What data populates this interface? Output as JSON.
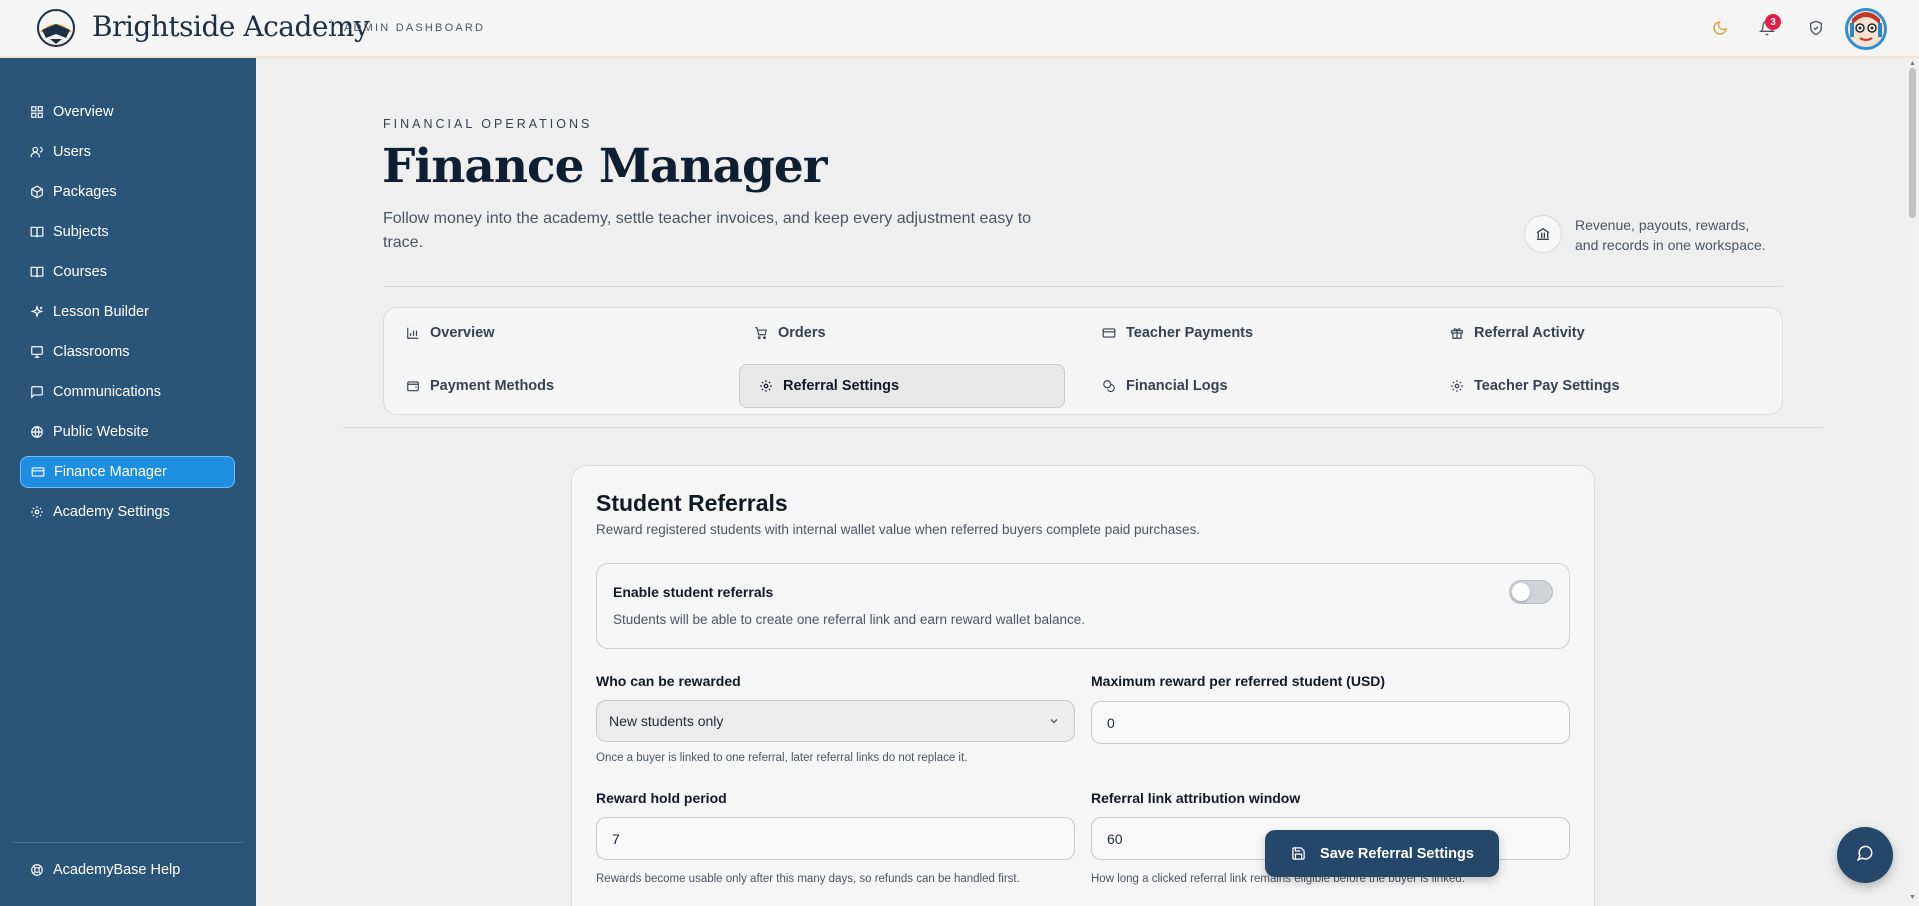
{
  "header": {
    "brand": "Brightside Academy",
    "subtitle": "ADMIN DASHBOARD",
    "notification_count": "3",
    "icons": [
      "moon-icon",
      "bell-icon",
      "shield-icon",
      "avatar"
    ]
  },
  "sidebar": {
    "items": [
      {
        "label": "Overview",
        "icon": "grid-icon"
      },
      {
        "label": "Users",
        "icon": "users-icon"
      },
      {
        "label": "Packages",
        "icon": "package-icon"
      },
      {
        "label": "Subjects",
        "icon": "book-icon"
      },
      {
        "label": "Courses",
        "icon": "book-open-icon"
      },
      {
        "label": "Lesson Builder",
        "icon": "sparkles-icon"
      },
      {
        "label": "Classrooms",
        "icon": "presentation-icon"
      },
      {
        "label": "Communications",
        "icon": "message-icon"
      },
      {
        "label": "Public Website",
        "icon": "globe-icon"
      },
      {
        "label": "Finance Manager",
        "icon": "credit-card-icon",
        "active": true
      },
      {
        "label": "Academy Settings",
        "icon": "gear-icon"
      }
    ],
    "help": {
      "label": "AcademyBase Help",
      "icon": "lifebuoy-icon"
    }
  },
  "page": {
    "eyebrow": "FINANCIAL OPERATIONS",
    "title": "Finance Manager",
    "description": "Follow money into the academy, settle teacher invoices, and keep every adjustment easy to trace.",
    "side_note": "Revenue, payouts, rewards, and records in one workspace."
  },
  "tabs": [
    {
      "label": "Overview",
      "icon": "bar-chart-icon"
    },
    {
      "label": "Orders",
      "icon": "cart-icon"
    },
    {
      "label": "Teacher Payments",
      "icon": "card-icon"
    },
    {
      "label": "Referral Activity",
      "icon": "gift-icon"
    },
    {
      "label": "Payment Methods",
      "icon": "wallet-icon"
    },
    {
      "label": "Referral Settings",
      "icon": "gear-icon",
      "active": true
    },
    {
      "label": "Financial Logs",
      "icon": "coins-icon"
    },
    {
      "label": "Teacher Pay Settings",
      "icon": "gear-icon"
    }
  ],
  "referrals": {
    "title": "Student Referrals",
    "description": "Reward registered students with internal wallet value when referred buyers complete paid purchases.",
    "toggle": {
      "label": "Enable student referrals",
      "description": "Students will be able to create one referral link and earn reward wallet balance.",
      "enabled": false
    },
    "who_rewarded": {
      "label": "Who can be rewarded",
      "value": "New students only",
      "hint": "Once a buyer is linked to one referral, later referral links do not replace it."
    },
    "max_reward": {
      "label": "Maximum reward per referred student (USD)",
      "value": "0"
    },
    "hold_period": {
      "label": "Reward hold period",
      "value": "7",
      "hint": "Rewards become usable only after this many days, so refunds can be handled first."
    },
    "attribution_window": {
      "label": "Referral link attribution window",
      "value": "60",
      "hint": "How long a clicked referral link remains eligible before the buyer is linked."
    }
  },
  "actions": {
    "save_label": "Save Referral Settings"
  },
  "colors": {
    "sidebar_bg": "#2a5478",
    "active_item": "#1e8fe0",
    "primary_button": "#24476a",
    "badge": "#e11d48",
    "moon": "#e0a030"
  }
}
